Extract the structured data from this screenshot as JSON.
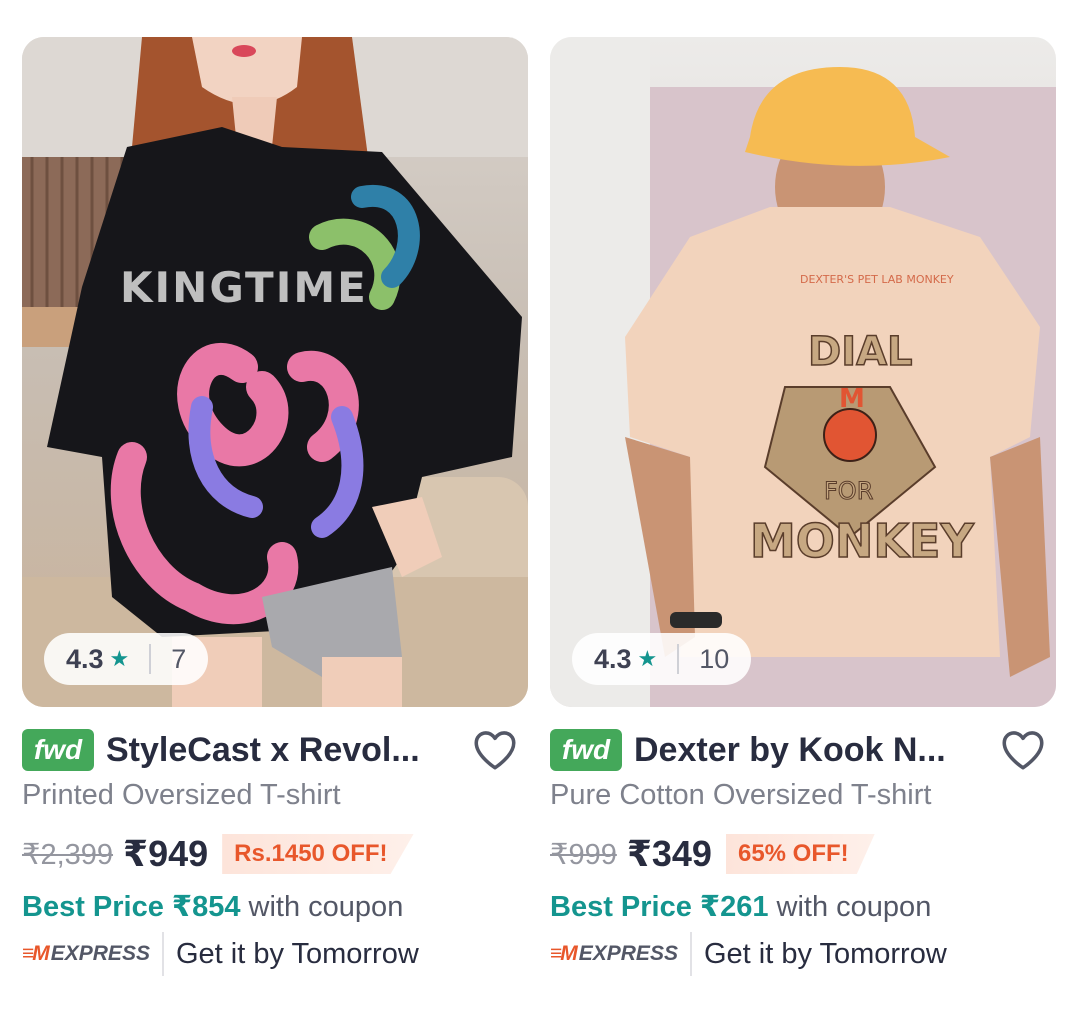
{
  "products": [
    {
      "image_alt": "woman wearing black oversized printed t-shirt",
      "rating": "4.3",
      "rating_count": "7",
      "badge": "fwd",
      "brand": "StyleCast x Revol...",
      "subtitle": "Printed Oversized T-shirt",
      "mrp": "₹2,399",
      "price": "₹949",
      "discount": "Rs.1450 OFF!",
      "best_price_label": "Best Price ₹854",
      "best_price_suffix": "with coupon",
      "express_label": "EXPRESS",
      "delivery": "Get it by Tomorrow"
    },
    {
      "image_alt": "man wearing beige oversized t-shirt with monkey back print",
      "rating": "4.3",
      "rating_count": "10",
      "badge": "fwd",
      "brand": "Dexter by Kook N...",
      "subtitle": "Pure Cotton Oversized T-shirt",
      "mrp": "₹999",
      "price": "₹349",
      "discount": "65% OFF!",
      "best_price_label": "Best Price ₹261",
      "best_price_suffix": "with coupon",
      "express_label": "EXPRESS",
      "delivery": "Get it by Tomorrow"
    }
  ],
  "print_texts": {
    "left_shirt": "KINGTIME",
    "right_small": "DEXTER'S PET LAB MONKEY",
    "right_dial": "DIAL",
    "right_m": "M",
    "right_for": "FOR",
    "right_monkey": "MONKEY"
  },
  "colors": {
    "accent_teal": "#14958f",
    "discount_orange": "#e8572b",
    "fwd_green": "#44a85a",
    "text_dark": "#282c3f",
    "text_grey": "#7e818c"
  },
  "icons": [
    "star-icon",
    "heart-icon",
    "express-logo-icon"
  ]
}
